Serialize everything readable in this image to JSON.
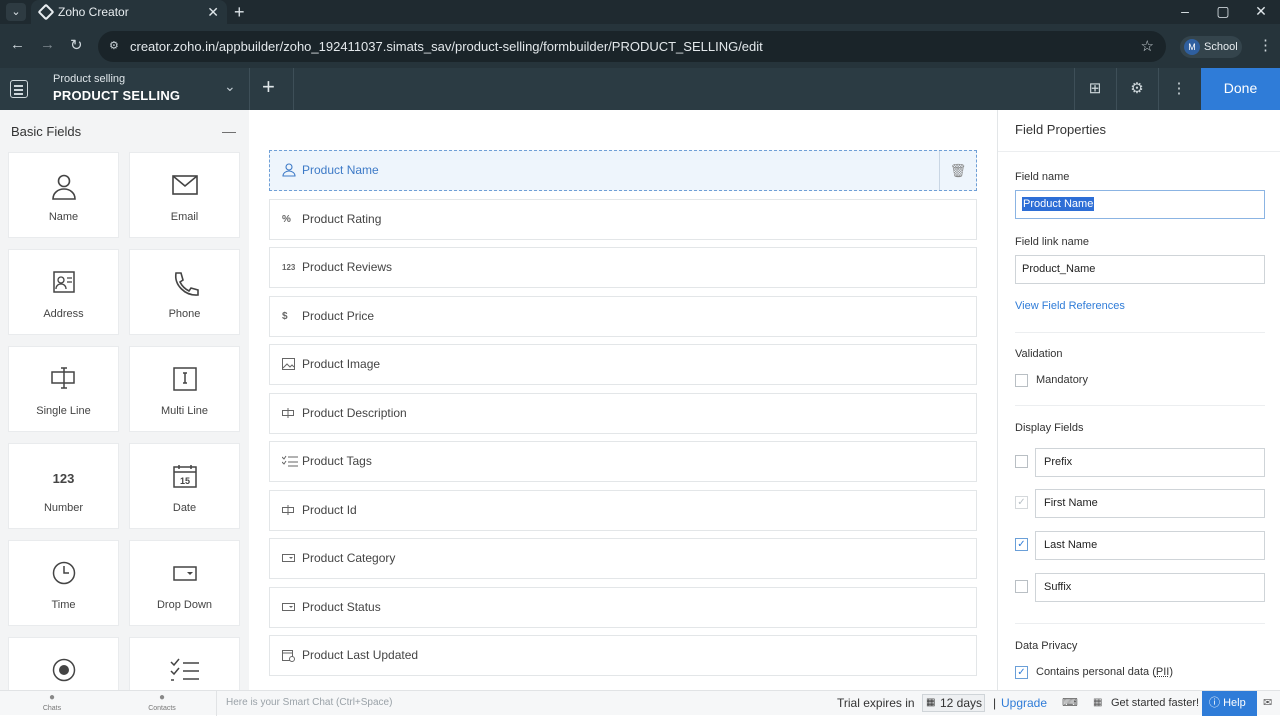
{
  "browser": {
    "tab_title": "Zoho Creator",
    "url": "creator.zoho.in/appbuilder/zoho_192411037.simats_sav/product-selling/formbuilder/PRODUCT_SELLING/edit",
    "profile_initial": "M",
    "profile_name": "School"
  },
  "header": {
    "app_name": "Product selling",
    "form_name": "PRODUCT SELLING",
    "done_label": "Done"
  },
  "left_panel": {
    "title": "Basic Fields",
    "tiles": [
      {
        "label": "Name",
        "icon": "person-icon"
      },
      {
        "label": "Email",
        "icon": "envelope-icon"
      },
      {
        "label": "Address",
        "icon": "address-card-icon"
      },
      {
        "label": "Phone",
        "icon": "phone-icon"
      },
      {
        "label": "Single Line",
        "icon": "single-line-icon"
      },
      {
        "label": "Multi Line",
        "icon": "multi-line-icon"
      },
      {
        "label": "Number",
        "icon": "number-icon",
        "glyph": "123"
      },
      {
        "label": "Date",
        "icon": "calendar-icon",
        "glyph": "15"
      },
      {
        "label": "Time",
        "icon": "clock-icon"
      },
      {
        "label": "Drop Down",
        "icon": "dropdown-icon"
      },
      {
        "label": "",
        "icon": "radio-icon"
      },
      {
        "label": "",
        "icon": "checklist-icon"
      }
    ]
  },
  "form_fields": [
    {
      "label": "Product Name",
      "icon": "person-icon",
      "selected": true
    },
    {
      "label": "Product Rating",
      "icon": "percent-icon",
      "glyph": "%"
    },
    {
      "label": "Product Reviews",
      "icon": "number-icon",
      "glyph": "123"
    },
    {
      "label": "Product Price",
      "icon": "dollar-icon",
      "glyph": "$"
    },
    {
      "label": "Product Image",
      "icon": "image-icon"
    },
    {
      "label": "Product Description",
      "icon": "single-line-icon"
    },
    {
      "label": "Product Tags",
      "icon": "checklist-icon"
    },
    {
      "label": "Product Id",
      "icon": "single-line-icon"
    },
    {
      "label": "Product Category",
      "icon": "dropdown-icon"
    },
    {
      "label": "Product Status",
      "icon": "dropdown-icon"
    },
    {
      "label": "Product Last Updated",
      "icon": "datetime-icon"
    }
  ],
  "properties": {
    "title": "Field Properties",
    "field_name_label": "Field name",
    "field_name_value": "Product Name",
    "field_link_name_label": "Field link name",
    "field_link_name_value": "Product_Name",
    "view_references": "View Field References",
    "validation_title": "Validation",
    "mandatory_label": "Mandatory",
    "display_fields_title": "Display Fields",
    "display_fields": [
      {
        "label": "Prefix",
        "checked": false,
        "disabled": false
      },
      {
        "label": "First Name",
        "checked": true,
        "disabled": true
      },
      {
        "label": "Last Name",
        "checked": true,
        "disabled": false
      },
      {
        "label": "Suffix",
        "checked": false,
        "disabled": false
      }
    ],
    "data_privacy_title": "Data Privacy",
    "pii_label": "Contains personal data (",
    "pii_abbr": "PII",
    "pii_close": ")"
  },
  "bottom_bar": {
    "chats": "Chats",
    "contacts": "Contacts",
    "chat_placeholder": "Here is your Smart Chat (Ctrl+Space)",
    "trial_text": "Trial expires in",
    "days": "12 days",
    "separator": "|",
    "upgrade": "Upgrade",
    "get_started": "Get started faster!",
    "help": "Help"
  },
  "colors": {
    "accent": "#2f7cd8",
    "header_bg": "#2b3b43",
    "selected_field_bg": "#eef5fc"
  }
}
